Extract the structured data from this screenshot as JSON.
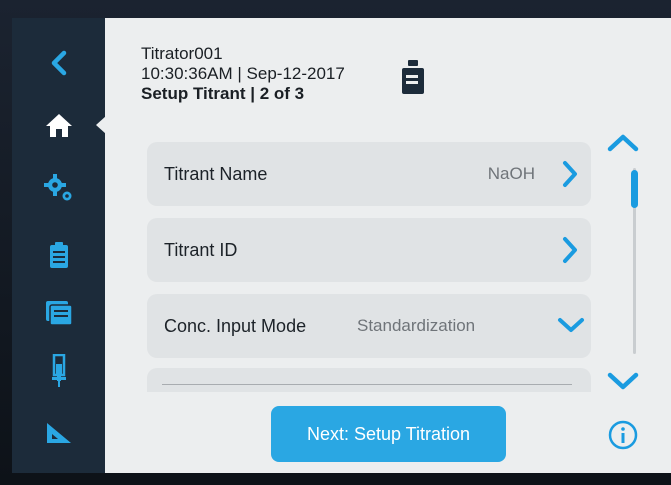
{
  "header": {
    "device": "Titrator001",
    "timestamp": "10:30:36AM | Sep-12-2017",
    "step": "Setup Titrant | 2 of 3"
  },
  "sidebar": {
    "items": [
      {
        "icon": "back-icon"
      },
      {
        "icon": "home-icon",
        "active": true
      },
      {
        "icon": "gears-icon"
      },
      {
        "icon": "clipboard-icon"
      },
      {
        "icon": "folders-icon"
      },
      {
        "icon": "burette-icon"
      },
      {
        "icon": "ruler-triangle-icon"
      }
    ]
  },
  "settings": {
    "rows": [
      {
        "label": "Titrant Name",
        "value": "NaOH",
        "control": "chevron-right"
      },
      {
        "label": "Titrant ID",
        "value": "",
        "control": "chevron-right"
      },
      {
        "label": "Conc. Input Mode",
        "value": "Standardization",
        "control": "chevron-down"
      }
    ]
  },
  "footer": {
    "next_label": "Next: Setup Titration"
  },
  "colors": {
    "accent": "#1a9be0",
    "button": "#2aa7e3",
    "sidebar": "#1c2b3a",
    "background": "#eceeef",
    "row": "#e0e3e5"
  }
}
